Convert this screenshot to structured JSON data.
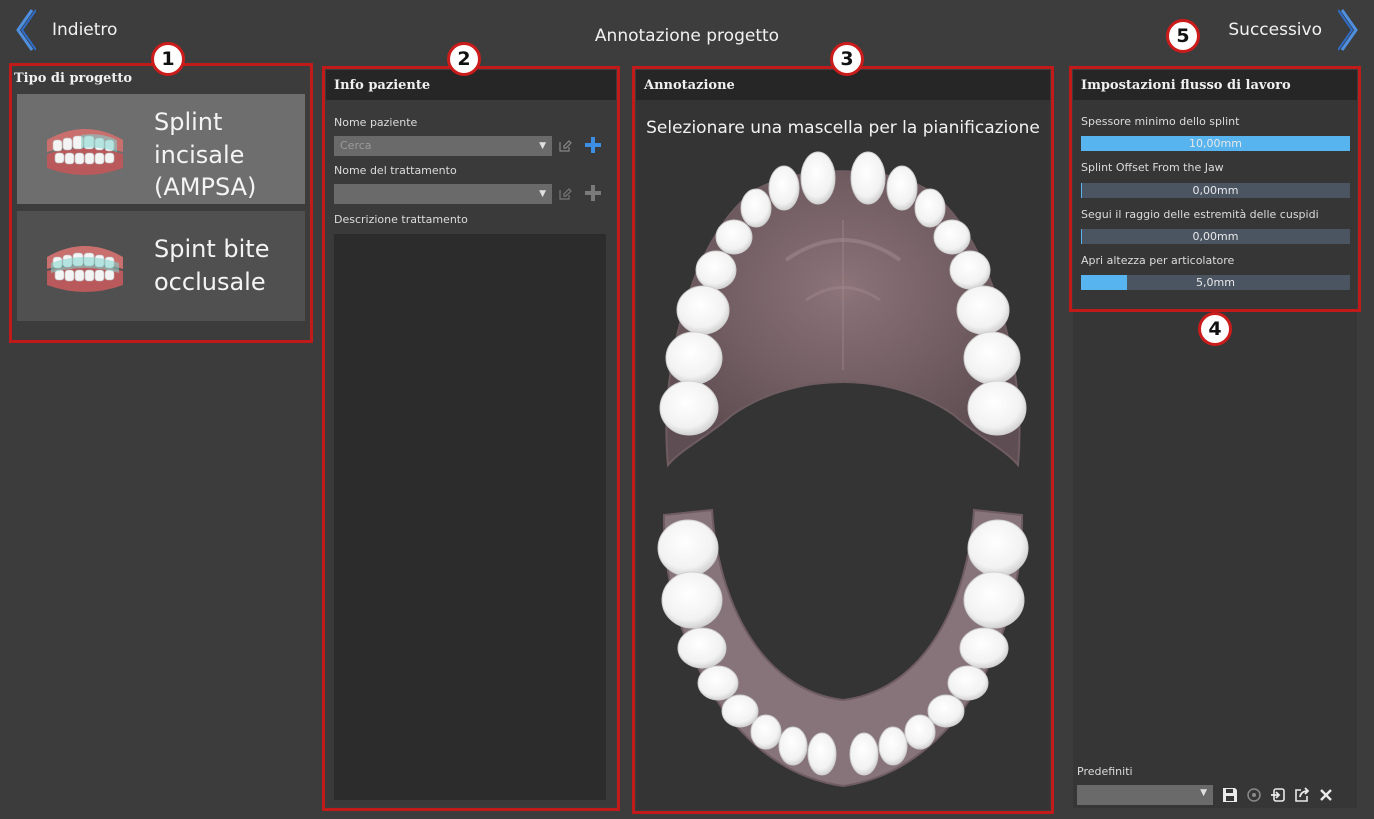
{
  "header": {
    "back_label": "Indietro",
    "title": "Annotazione progetto",
    "next_label": "Successivo"
  },
  "project_type": {
    "title": "Tipo di progetto",
    "cards": [
      {
        "label": "Splint incisale (AMPSA)"
      },
      {
        "label": "Spint bite occlusale"
      }
    ]
  },
  "patient": {
    "title": "Info paziente",
    "name_label": "Nome paziente",
    "name_placeholder": "Cerca",
    "treatment_label": "Nome del trattamento",
    "treatment_value": "",
    "description_label": "Descrizione trattamento"
  },
  "annotation": {
    "title": "Annotazione",
    "instruction": "Selezionare una mascella per la pianificazione"
  },
  "workflow": {
    "title": "Impostazioni flusso di lavoro",
    "settings": [
      {
        "label": "Spessore minimo dello splint",
        "value": "10,00mm",
        "fill": 1.0
      },
      {
        "label": "Splint Offset From the Jaw",
        "value": "0,00mm",
        "fill": 0.0
      },
      {
        "label": "Segui il raggio delle estremità delle cuspidi",
        "value": "0,00mm",
        "fill": 0.0
      },
      {
        "label": "Apri altezza per articolatore",
        "value": "5,0mm",
        "fill": 0.17
      }
    ],
    "presets_label": "Predefiniti"
  },
  "badges": [
    "1",
    "2",
    "3",
    "4",
    "5"
  ],
  "colors": {
    "accent_blue": "#58b4ee",
    "highlight_red": "#c11a1a",
    "background": "#3c3c3c"
  },
  "icons": [
    "chevron-left-icon",
    "chevron-right-icon",
    "edit-icon",
    "plus-icon",
    "save-icon",
    "apply-icon",
    "import-icon",
    "export-icon",
    "close-icon"
  ]
}
